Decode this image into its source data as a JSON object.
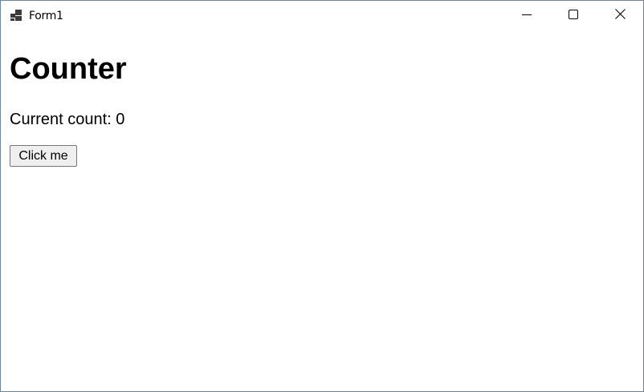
{
  "window": {
    "title": "Form1",
    "controls": {
      "minimize": "minimize",
      "maximize": "maximize",
      "close": "close"
    }
  },
  "page": {
    "heading": "Counter",
    "count_text": "Current count: 0",
    "button_label": "Click me"
  },
  "colors": {
    "window_border": "#6f8396",
    "background": "#ffffff",
    "button_bg": "#efefef",
    "button_border": "#767676"
  },
  "icons": {
    "app": "app-window-icon",
    "minimize": "minimize-icon",
    "maximize": "maximize-icon",
    "close": "close-icon"
  }
}
